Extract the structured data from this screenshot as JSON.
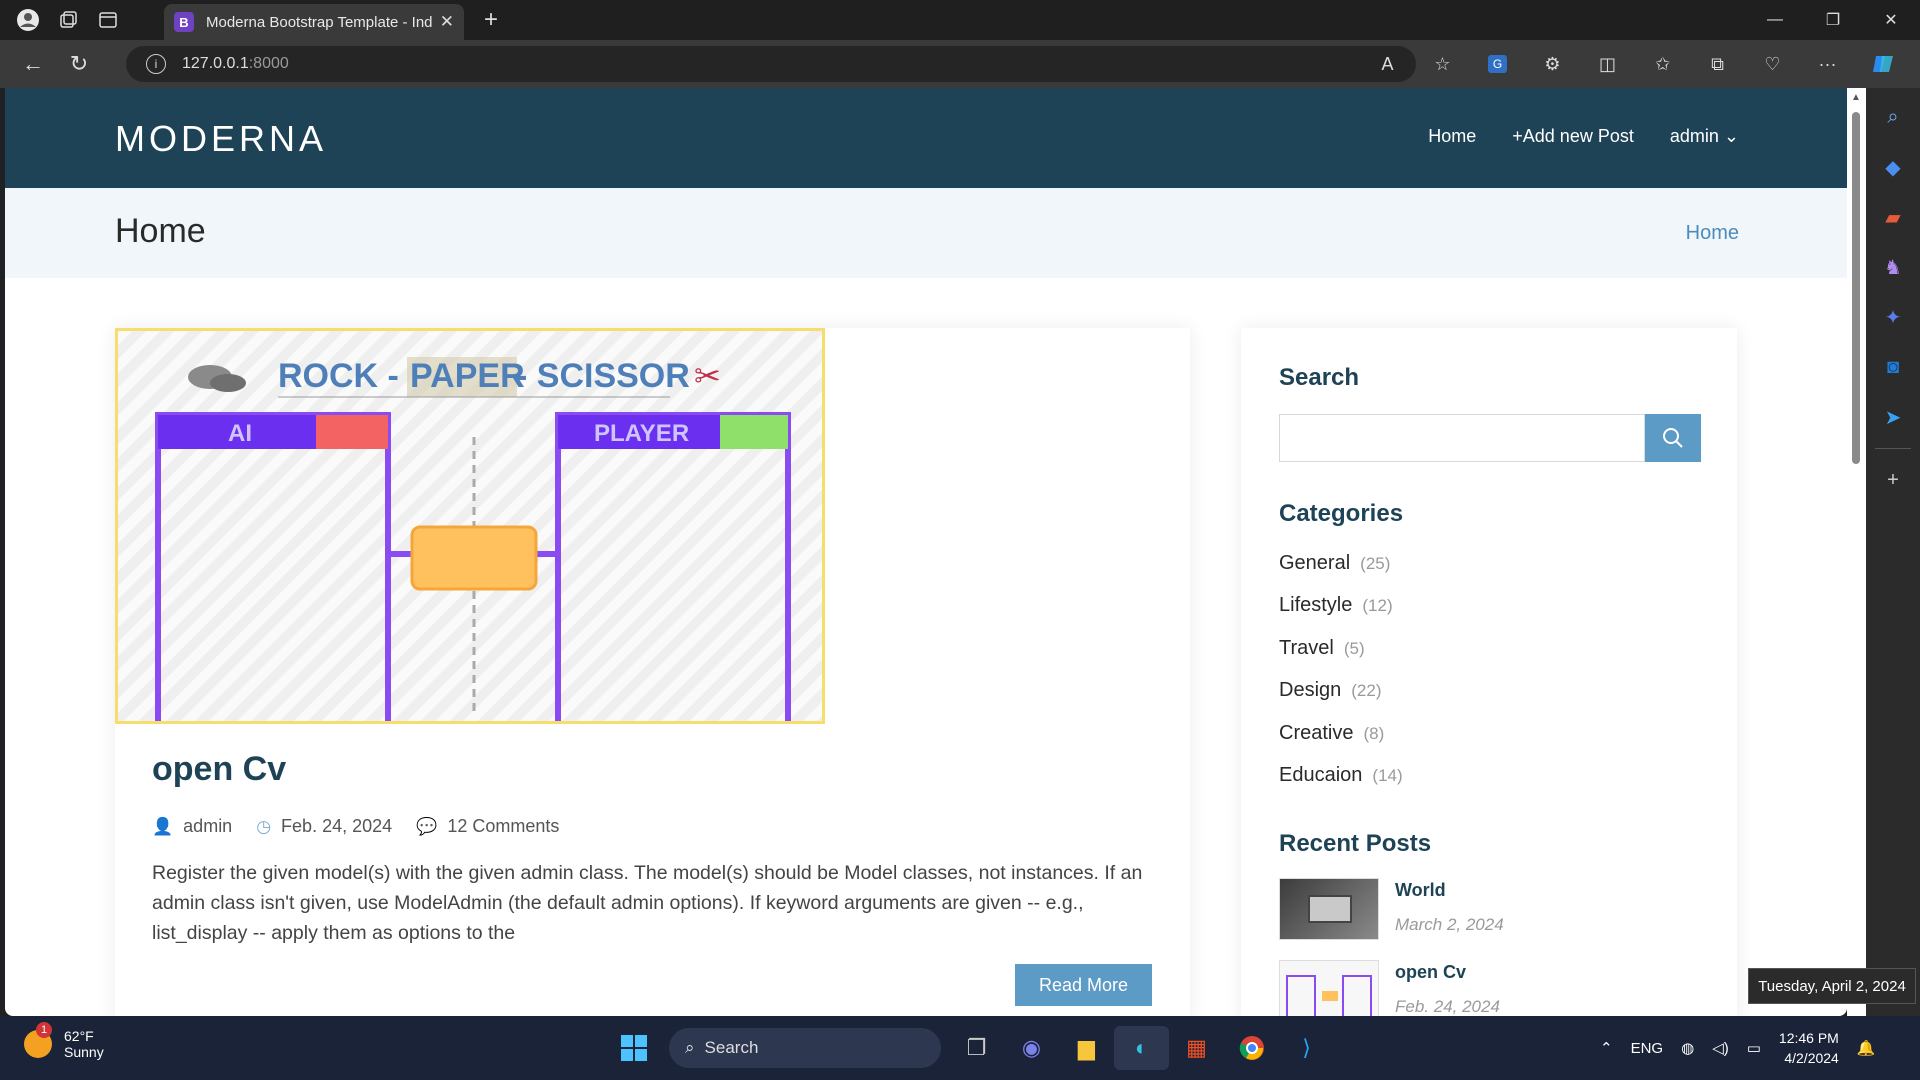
{
  "browser": {
    "tab_title": "Moderna Bootstrap Template - Index",
    "tab_favicon": "B",
    "url_host": "127.0.0.1",
    "url_port": ":8000",
    "translate_badge": "G"
  },
  "site": {
    "logo": "MODERNA",
    "nav": {
      "home": "Home",
      "add_post": "+Add new Post",
      "user": "admin"
    },
    "breadcrumb_title": "Home",
    "breadcrumb_link": "Home"
  },
  "post": {
    "image_title": {
      "part1": "ROCK - ",
      "part2": "PAPER",
      "part3": " - SCISSOR"
    },
    "image_labels": {
      "ai": "AI",
      "player": "PLAYER"
    },
    "title": "open Cv",
    "author": "admin",
    "date": "Feb. 24, 2024",
    "comments": "12 Comments",
    "excerpt": "Register the given model(s) with the given admin class. The model(s) should be Model classes, not instances. If an admin class isn't given, use ModelAdmin (the default admin options). If keyword arguments are given -- e.g., list_display -- apply them as options to the",
    "read_more": "Read More"
  },
  "sidebar": {
    "search_heading": "Search",
    "search_value": "",
    "categories_heading": "Categories",
    "categories": [
      {
        "name": "General",
        "count": "(25)"
      },
      {
        "name": "Lifestyle",
        "count": "(12)"
      },
      {
        "name": "Travel",
        "count": "(5)"
      },
      {
        "name": "Design",
        "count": "(22)"
      },
      {
        "name": "Creative",
        "count": "(8)"
      },
      {
        "name": "Educaion",
        "count": "(14)"
      }
    ],
    "recent_heading": "Recent Posts",
    "recent_posts": [
      {
        "title": "World",
        "date": "March 2, 2024"
      },
      {
        "title": "open Cv",
        "date": "Feb. 24, 2024"
      }
    ]
  },
  "tooltip": "Tuesday, April 2, 2024",
  "taskbar": {
    "weather_badge": "1",
    "temperature": "62°F",
    "condition": "Sunny",
    "search_label": "Search",
    "language": "ENG",
    "time": "12:46 PM",
    "date": "4/2/2024"
  },
  "colors": {
    "header_bg": "#1e4356",
    "accent": "#5c9bc6",
    "breadcrumb_bg": "#f0f6fa",
    "taskbar_bg": "#1a2337"
  }
}
